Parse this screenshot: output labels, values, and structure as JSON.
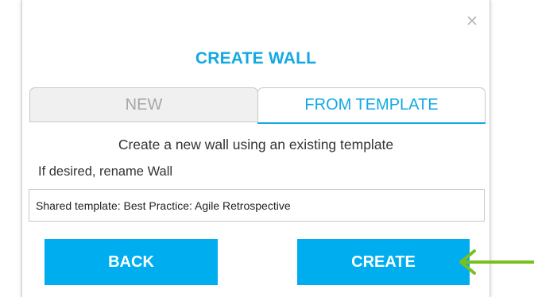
{
  "dialog": {
    "close_label": "×",
    "title": "CREATE WALL",
    "tabs": [
      {
        "label": "NEW",
        "active": false
      },
      {
        "label": "FROM TEMPLATE",
        "active": true
      }
    ],
    "subtitle": "Create a new wall using an existing template",
    "rename_label": "If desired, rename Wall",
    "name_input": {
      "value": "Shared template: Best Practice: Agile Retrospective"
    },
    "buttons": {
      "back_label": "BACK",
      "create_label": "CREATE"
    }
  },
  "annotation": {
    "arrow_icon": "left-arrow-icon",
    "arrow_color": "#7bbf1e"
  },
  "colors": {
    "accent": "#12a9e3",
    "button": "#00aeef",
    "inactive_tab_bg": "#f0f0f0",
    "inactive_tab_text": "#a6a6a6"
  }
}
